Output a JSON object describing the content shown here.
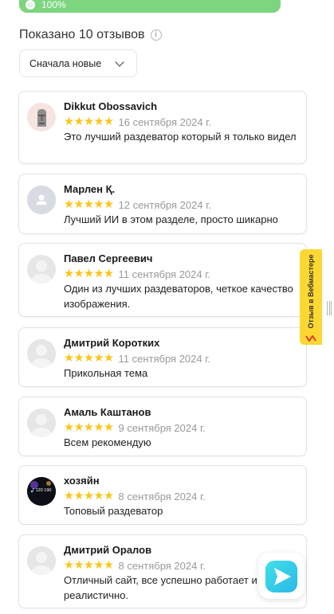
{
  "progress": {
    "label": "100%",
    "percent": 100,
    "color": "#7dd57f",
    "icon": "smile-icon"
  },
  "reviews_header": {
    "count_text": "Показано 10 отзывов",
    "info_icon": "info-icon"
  },
  "sort": {
    "selected": "Сначала новые"
  },
  "reviews": [
    {
      "name": "Dikkut Obossavich",
      "date": "16 сентября 2024 г.",
      "text": "Это лучший раздеватор который я только видел",
      "stars": 5,
      "avatar": "moai-avatar"
    },
    {
      "name": "Марлен Қ.",
      "date": "12 сентября 2024 г.",
      "text": "Лучший ИИ в этом разделе,  просто шикарно",
      "stars": 5,
      "avatar": "default-user-avatar"
    },
    {
      "name": "Павел Сергеевич",
      "date": "11 сентября 2024 г.",
      "text": "Один из лучших раздеваторов, четкое качество изображения.",
      "stars": 5,
      "avatar": "blank-avatar"
    },
    {
      "name": "Дмитрий Коротких",
      "date": "11 сентября 2024 г.",
      "text": "Прикольная тема",
      "stars": 5,
      "avatar": "blank-avatar"
    },
    {
      "name": "Амаль Каштанов",
      "date": "9 сентября 2024 г.",
      "text": "Всем рекомендую",
      "stars": 5,
      "avatar": "blank-avatar"
    },
    {
      "name": "хозяйн",
      "date": "8 сентября 2024 г.",
      "text": "Топовый раздеватор",
      "stars": 5,
      "avatar": "dark-photo-avatar",
      "avatar_text": "7 120 190"
    },
    {
      "name": "Дмитрий Оралов",
      "date": "8 сентября 2024 г.",
      "text": "Отличный сайт, все успешно работает и главное реалистично.",
      "stars": 5,
      "avatar": "blank-avatar"
    }
  ],
  "webmaster": {
    "label": "Отзыв в Вебмастере",
    "color": "#fdd832"
  },
  "chat": {
    "icon": "send-arrow-icon"
  },
  "colors": {
    "star": "#fcc519",
    "date": "#999999",
    "border": "#e2e2e2"
  }
}
